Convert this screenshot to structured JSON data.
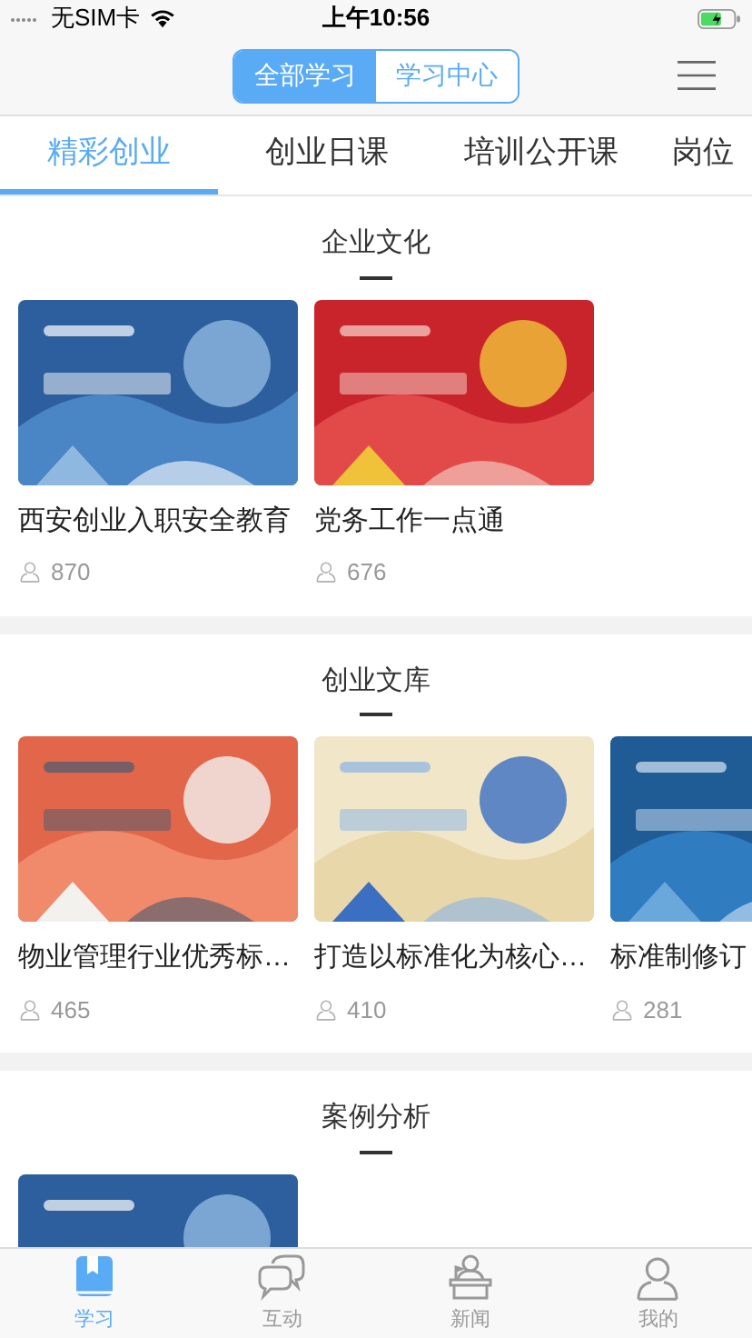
{
  "status_bar": {
    "carrier": "无SIM卡",
    "time": "上午10:56"
  },
  "segments": [
    {
      "label": "全部学习",
      "selected": true
    },
    {
      "label": "学习中心",
      "selected": false
    }
  ],
  "tabs": [
    {
      "label": "精彩创业",
      "selected": true
    },
    {
      "label": "创业日课",
      "selected": false
    },
    {
      "label": "培训公开课",
      "selected": false
    },
    {
      "label": "岗位",
      "selected": false
    }
  ],
  "sections": [
    {
      "title": "企业文化",
      "courses": [
        {
          "kind": "course",
          "title": "西安创业入职安全教育",
          "views": "870"
        },
        {
          "kind": "course",
          "title": "党务工作一点通",
          "views": "676"
        }
      ]
    },
    {
      "title": "创业文库",
      "courses": [
        {
          "kind": "course",
          "title": "物业管理行业优秀标…",
          "views": "465"
        },
        {
          "kind": "course",
          "title": "打造以标准化为核心…",
          "views": "410"
        },
        {
          "kind": "course",
          "title": "标准制修订",
          "views": "281"
        }
      ]
    },
    {
      "title": "案例分析"
    }
  ],
  "bottom_nav": [
    {
      "label": "学习",
      "selected": true
    },
    {
      "label": "互动",
      "selected": false
    },
    {
      "label": "新闻",
      "selected": false
    },
    {
      "label": "我的",
      "selected": false
    }
  ]
}
